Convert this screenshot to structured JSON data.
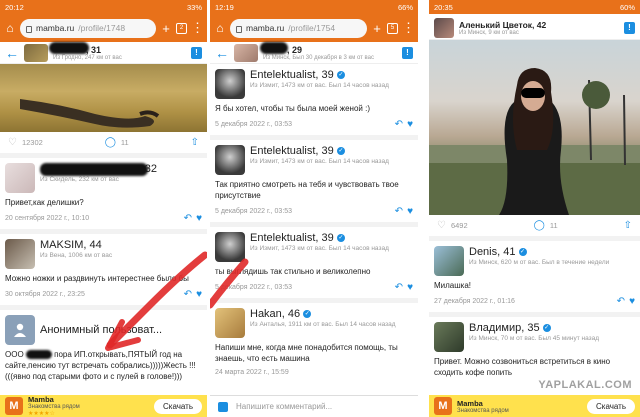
{
  "panel1": {
    "status": {
      "time": "20:12",
      "battery": "33%"
    },
    "url": {
      "domain": "mamba.ru",
      "path": "/profile/1748"
    },
    "header": {
      "name": ", 31",
      "sub": "Из Гродно, 247 км от вас"
    },
    "stats": {
      "likes": "12302",
      "comments": "11"
    },
    "cards": [
      {
        "name": ", 32",
        "sub": "Из Скидель, 232 км от вас",
        "text": "Привет,как делишки?",
        "date": "20 сентября 2022 г., 10:10"
      },
      {
        "name": "MAKSIM, 44",
        "sub": "Из Вена, 1006 км от вас",
        "text": "Можно ножки и раздвинуть интерестнее было бы",
        "date": "30 октября 2022 г., 23:25"
      },
      {
        "name": "Анонимный пользоват...",
        "text1": "ООО",
        "text2": "пора ИП.открывать,ПЯТЫЙ год на сайте,пенсию тут встречать собрались)))))Жесть !!!(((явно под старыми фото и с пулей в голове!)))"
      }
    ],
    "banner": {
      "title": "Mamba",
      "sub": "Знакомства рядом",
      "stars": "★★★★☆",
      "download": "Скачать"
    }
  },
  "panel2": {
    "status": {
      "time": "12:19",
      "battery": "66%"
    },
    "url": {
      "domain": "mamba.ru",
      "path": "/profile/1754"
    },
    "header": {
      "name": ", 29",
      "sub": "Из Минск, Был 30 декабря в 3 км от вас"
    },
    "cards": [
      {
        "name": "Entelektualist, 39",
        "sub": "Из Измит, 1473 км от вас. Был 14 часов назад",
        "text": "Я бы хотел, чтобы ты была моей женой :)",
        "date": "5 декабря 2022 г., 03:53"
      },
      {
        "name": "Entelektualist, 39",
        "sub": "Из Измит, 1473 км от вас. Был 14 часов назад",
        "text": "Так приятно смотреть на тебя и чувствовать твое присутствие",
        "date": "5 декабря 2022 г., 03:53"
      },
      {
        "name": "Entelektualist, 39",
        "sub": "Из Измит, 1473 км от вас. Был 14 часов назад",
        "text": "ты выглядишь так стильно и великолепно",
        "date": "5 декабря 2022 г., 03:53"
      },
      {
        "name": "Hakan, 46",
        "sub": "Из Анталья, 1911 км от вас. Был 14 часов назад",
        "text": "Напиши мне, когда мне понадобится помощь, ты знаешь, что есть машина",
        "date": "24 марта 2022 г., 15:59"
      }
    ],
    "comment_placeholder": "Напишите комментарий..."
  },
  "panel3": {
    "status": {
      "time": "20:35",
      "battery": "60%"
    },
    "header": {
      "name": "Аленький Цветок, 42",
      "sub": "Из Минск, 9 км от вас"
    },
    "stats": {
      "likes": "6492",
      "comments": "11"
    },
    "cards": [
      {
        "name": "Denis, 41",
        "sub": "Из Минск, 620 м от вас. Был в течение недели",
        "text": "Милашка!",
        "date": "27 декабря 2022 г., 01:16"
      },
      {
        "name": "Владимир, 35",
        "sub": "Из Минск, 70 м от вас. Был 45 минут назад",
        "text": "Привет. Можно созвониться встретиться в кино сходить кофе попить",
        "date": "27 декабря 2022 г., 01:26"
      }
    ],
    "banner": {
      "title": "Mamba",
      "sub": "Знакомства рядом",
      "download": "Скачать"
    },
    "watermark": "YAPLAKAL.COM"
  }
}
